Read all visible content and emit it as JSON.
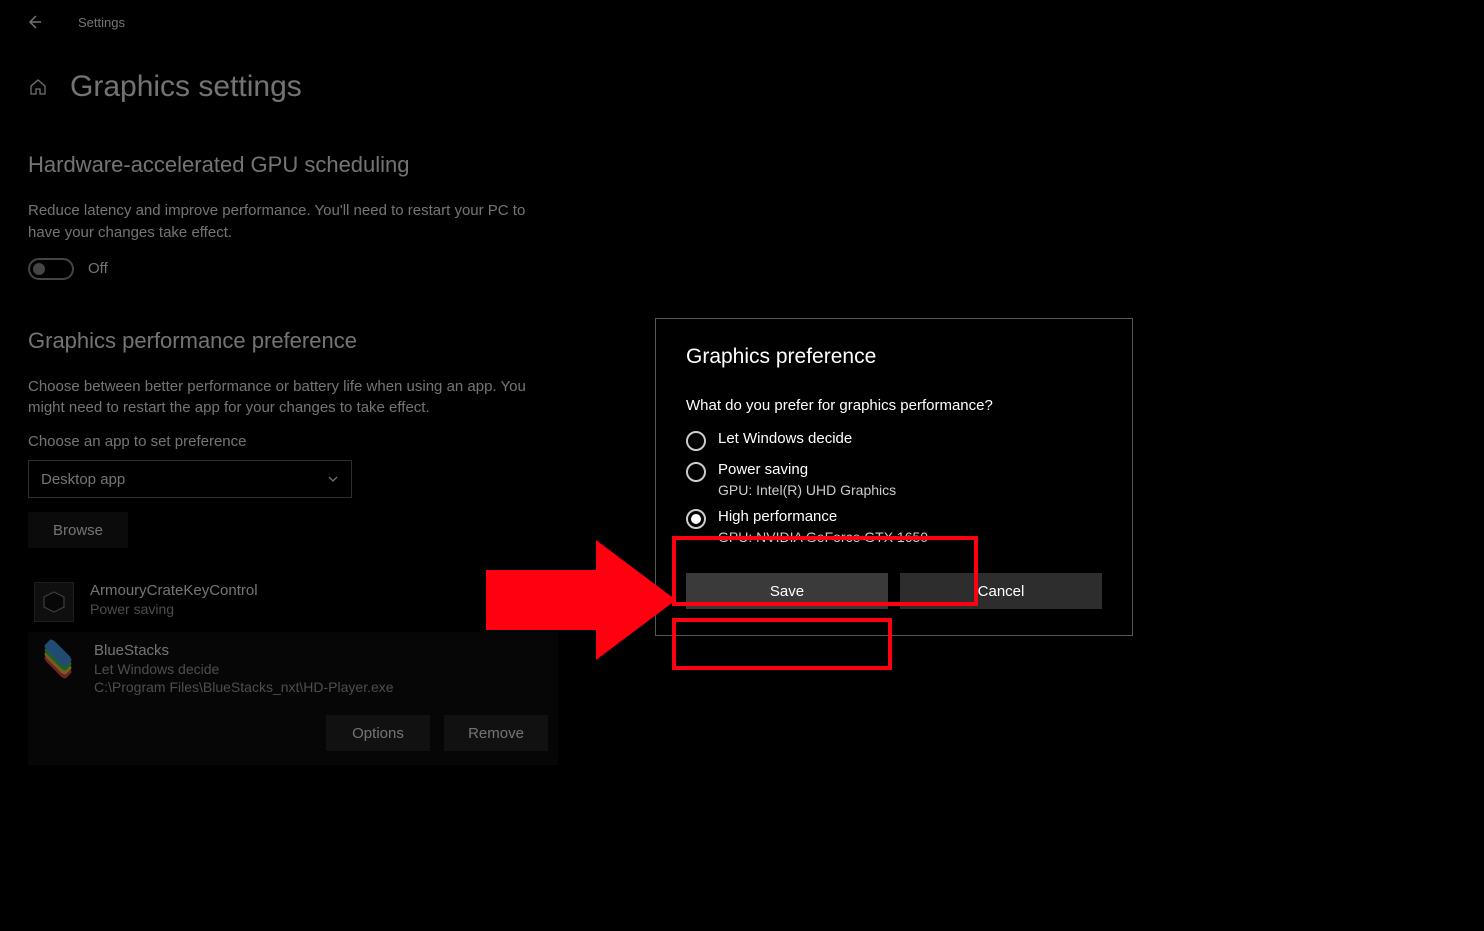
{
  "topbar": {
    "title": "Settings"
  },
  "page": {
    "heading": "Graphics settings"
  },
  "hw": {
    "heading": "Hardware-accelerated GPU scheduling",
    "desc": "Reduce latency and improve performance. You'll need to restart your PC to have your changes take effect.",
    "toggle_label": "Off"
  },
  "pref": {
    "heading": "Graphics performance preference",
    "desc": "Choose between better performance or battery life when using an app. You might need to restart the app for your changes to take effect.",
    "choose_label": "Choose an app to set preference",
    "select_value": "Desktop app",
    "browse_label": "Browse",
    "options_label": "Options",
    "remove_label": "Remove"
  },
  "apps": [
    {
      "name": "ArmouryCrateKeyControl",
      "sub": "Power saving"
    },
    {
      "name": "BlueStacks",
      "sub": "Let Windows decide",
      "path": "C:\\Program Files\\BlueStacks_nxt\\HD-Player.exe"
    }
  ],
  "dialog": {
    "title": "Graphics preference",
    "question": "What do you prefer for graphics performance?",
    "opts": [
      {
        "label": "Let Windows decide",
        "sub": ""
      },
      {
        "label": "Power saving",
        "sub": "GPU: Intel(R) UHD Graphics"
      },
      {
        "label": "High performance",
        "sub": "GPU: NVIDIA GeForce GTX 1650"
      }
    ],
    "save": "Save",
    "cancel": "Cancel"
  }
}
